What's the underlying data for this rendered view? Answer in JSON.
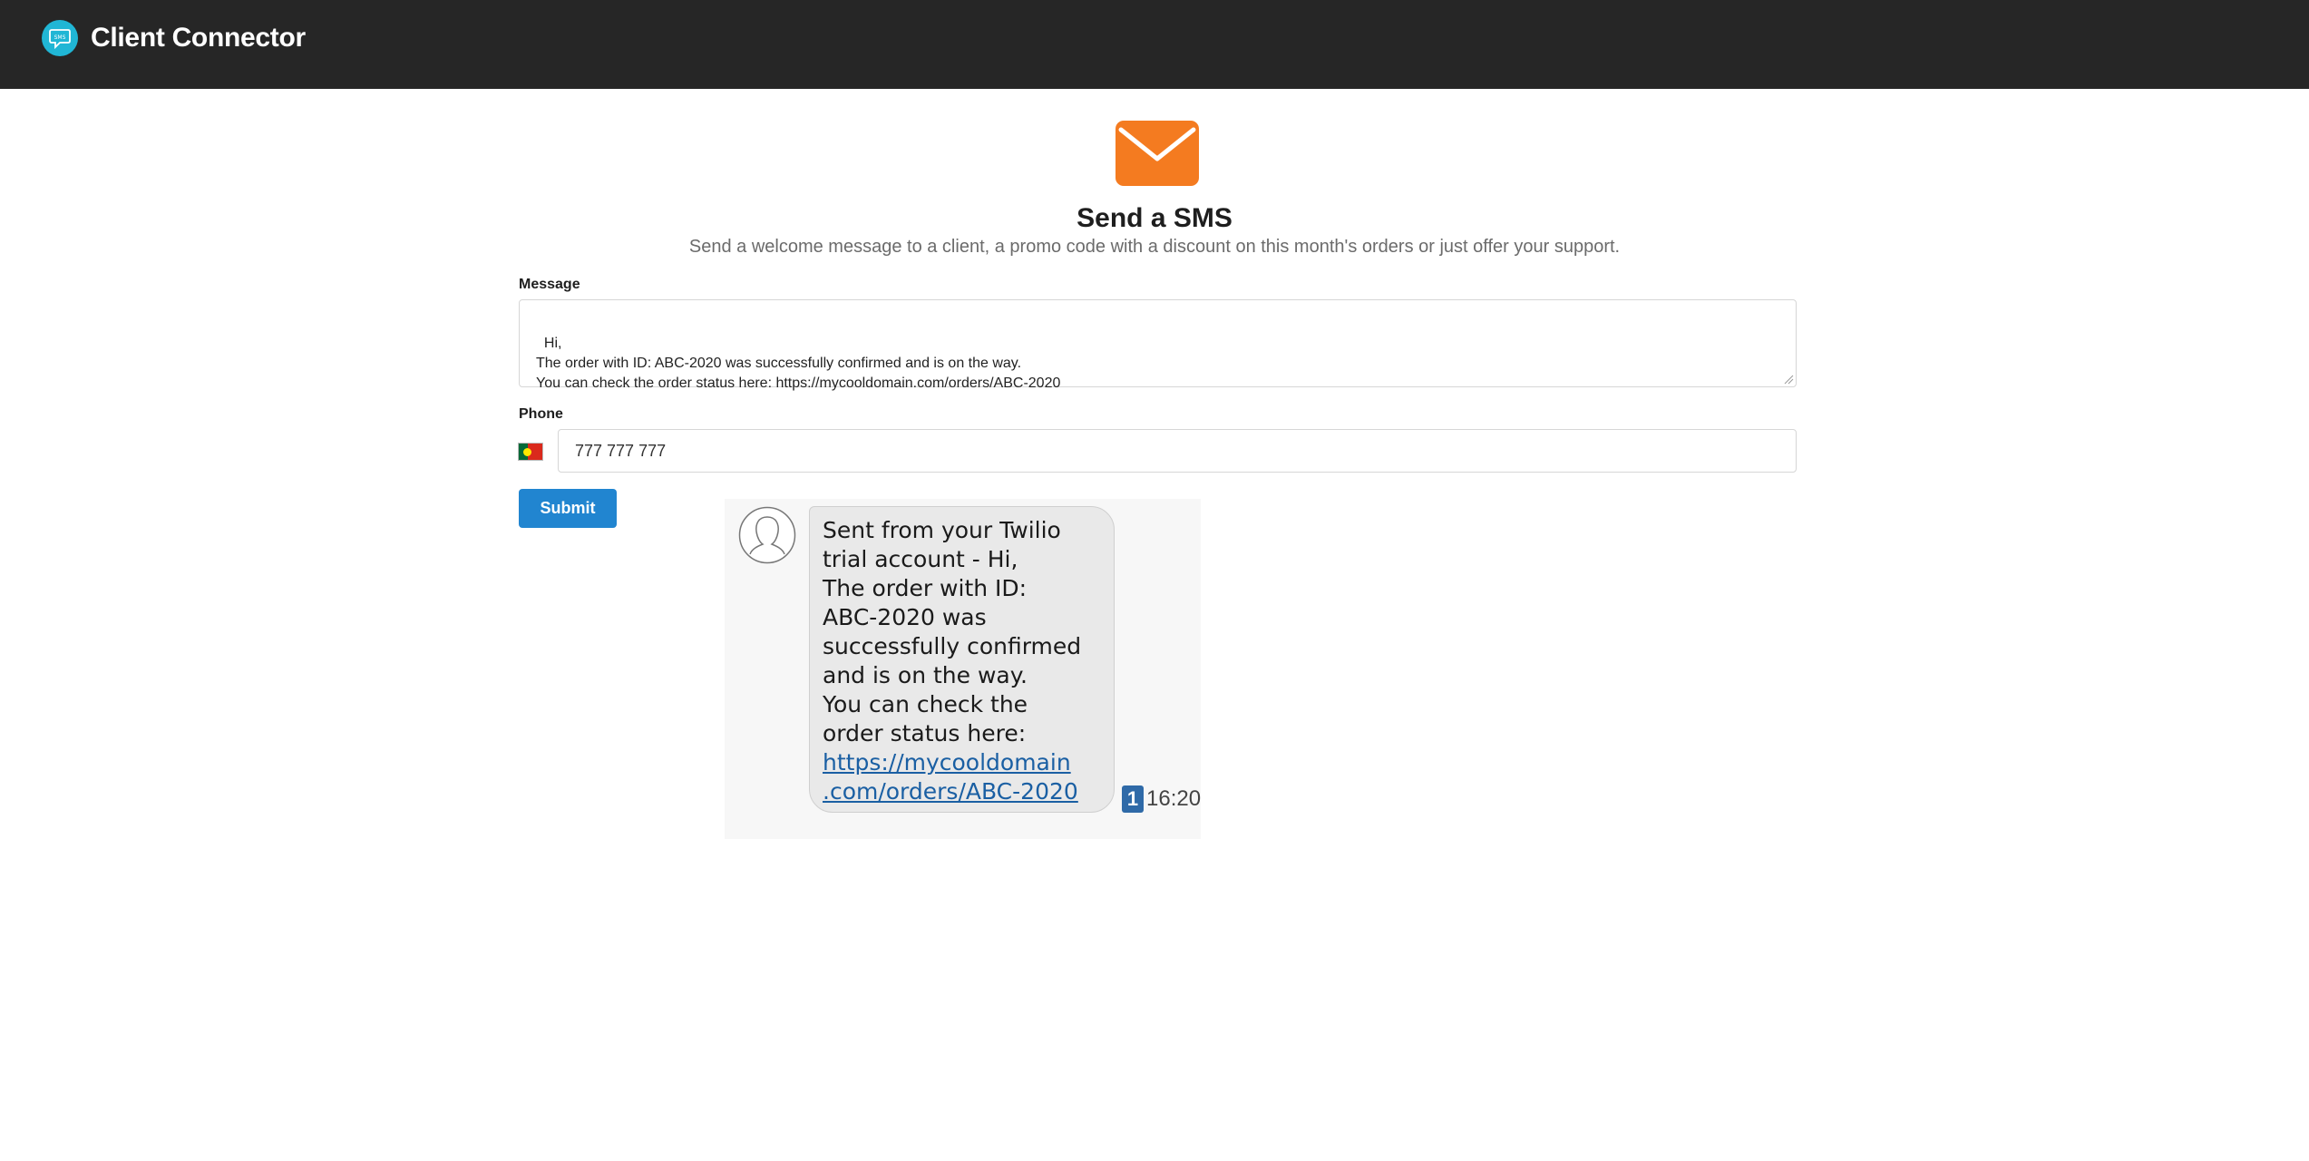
{
  "header": {
    "app_title": "Client Connector",
    "logo_icon": "sms-chat-bubble-icon",
    "logo_text": "SMS"
  },
  "hero": {
    "icon": "envelope-icon",
    "title": "Send a SMS",
    "subtitle": "Send a welcome message to a client, a promo code with a discount on this month's orders or just offer your support."
  },
  "form": {
    "message_label": "Message",
    "message_value": "Hi,\nThe order with ID: ABC-2020 was successfully confirmed and is on the way.\nYou can check the order status here: https://mycooldomain.com/orders/ABC-2020",
    "phone_label": "Phone",
    "phone_country": "Portugal",
    "phone_value": "777 777 777",
    "submit_label": "Submit"
  },
  "sms_preview": {
    "lines": [
      "Sent from your Twilio",
      "trial account - Hi,",
      "The order with ID:",
      "ABC-2020 was",
      "successfully confirmed",
      "and is on the way.",
      "You can check the",
      "order status here:"
    ],
    "link_lines": [
      "https://mycooldomain",
      ".com/orders/ABC-2020"
    ],
    "sim_slot": "1",
    "time": "16:20"
  },
  "colors": {
    "header_bg": "#262626",
    "logo_accent": "#20b6d5",
    "envelope": "#f47b20",
    "primary_button": "#2185d0",
    "link": "#1a5fa3"
  }
}
